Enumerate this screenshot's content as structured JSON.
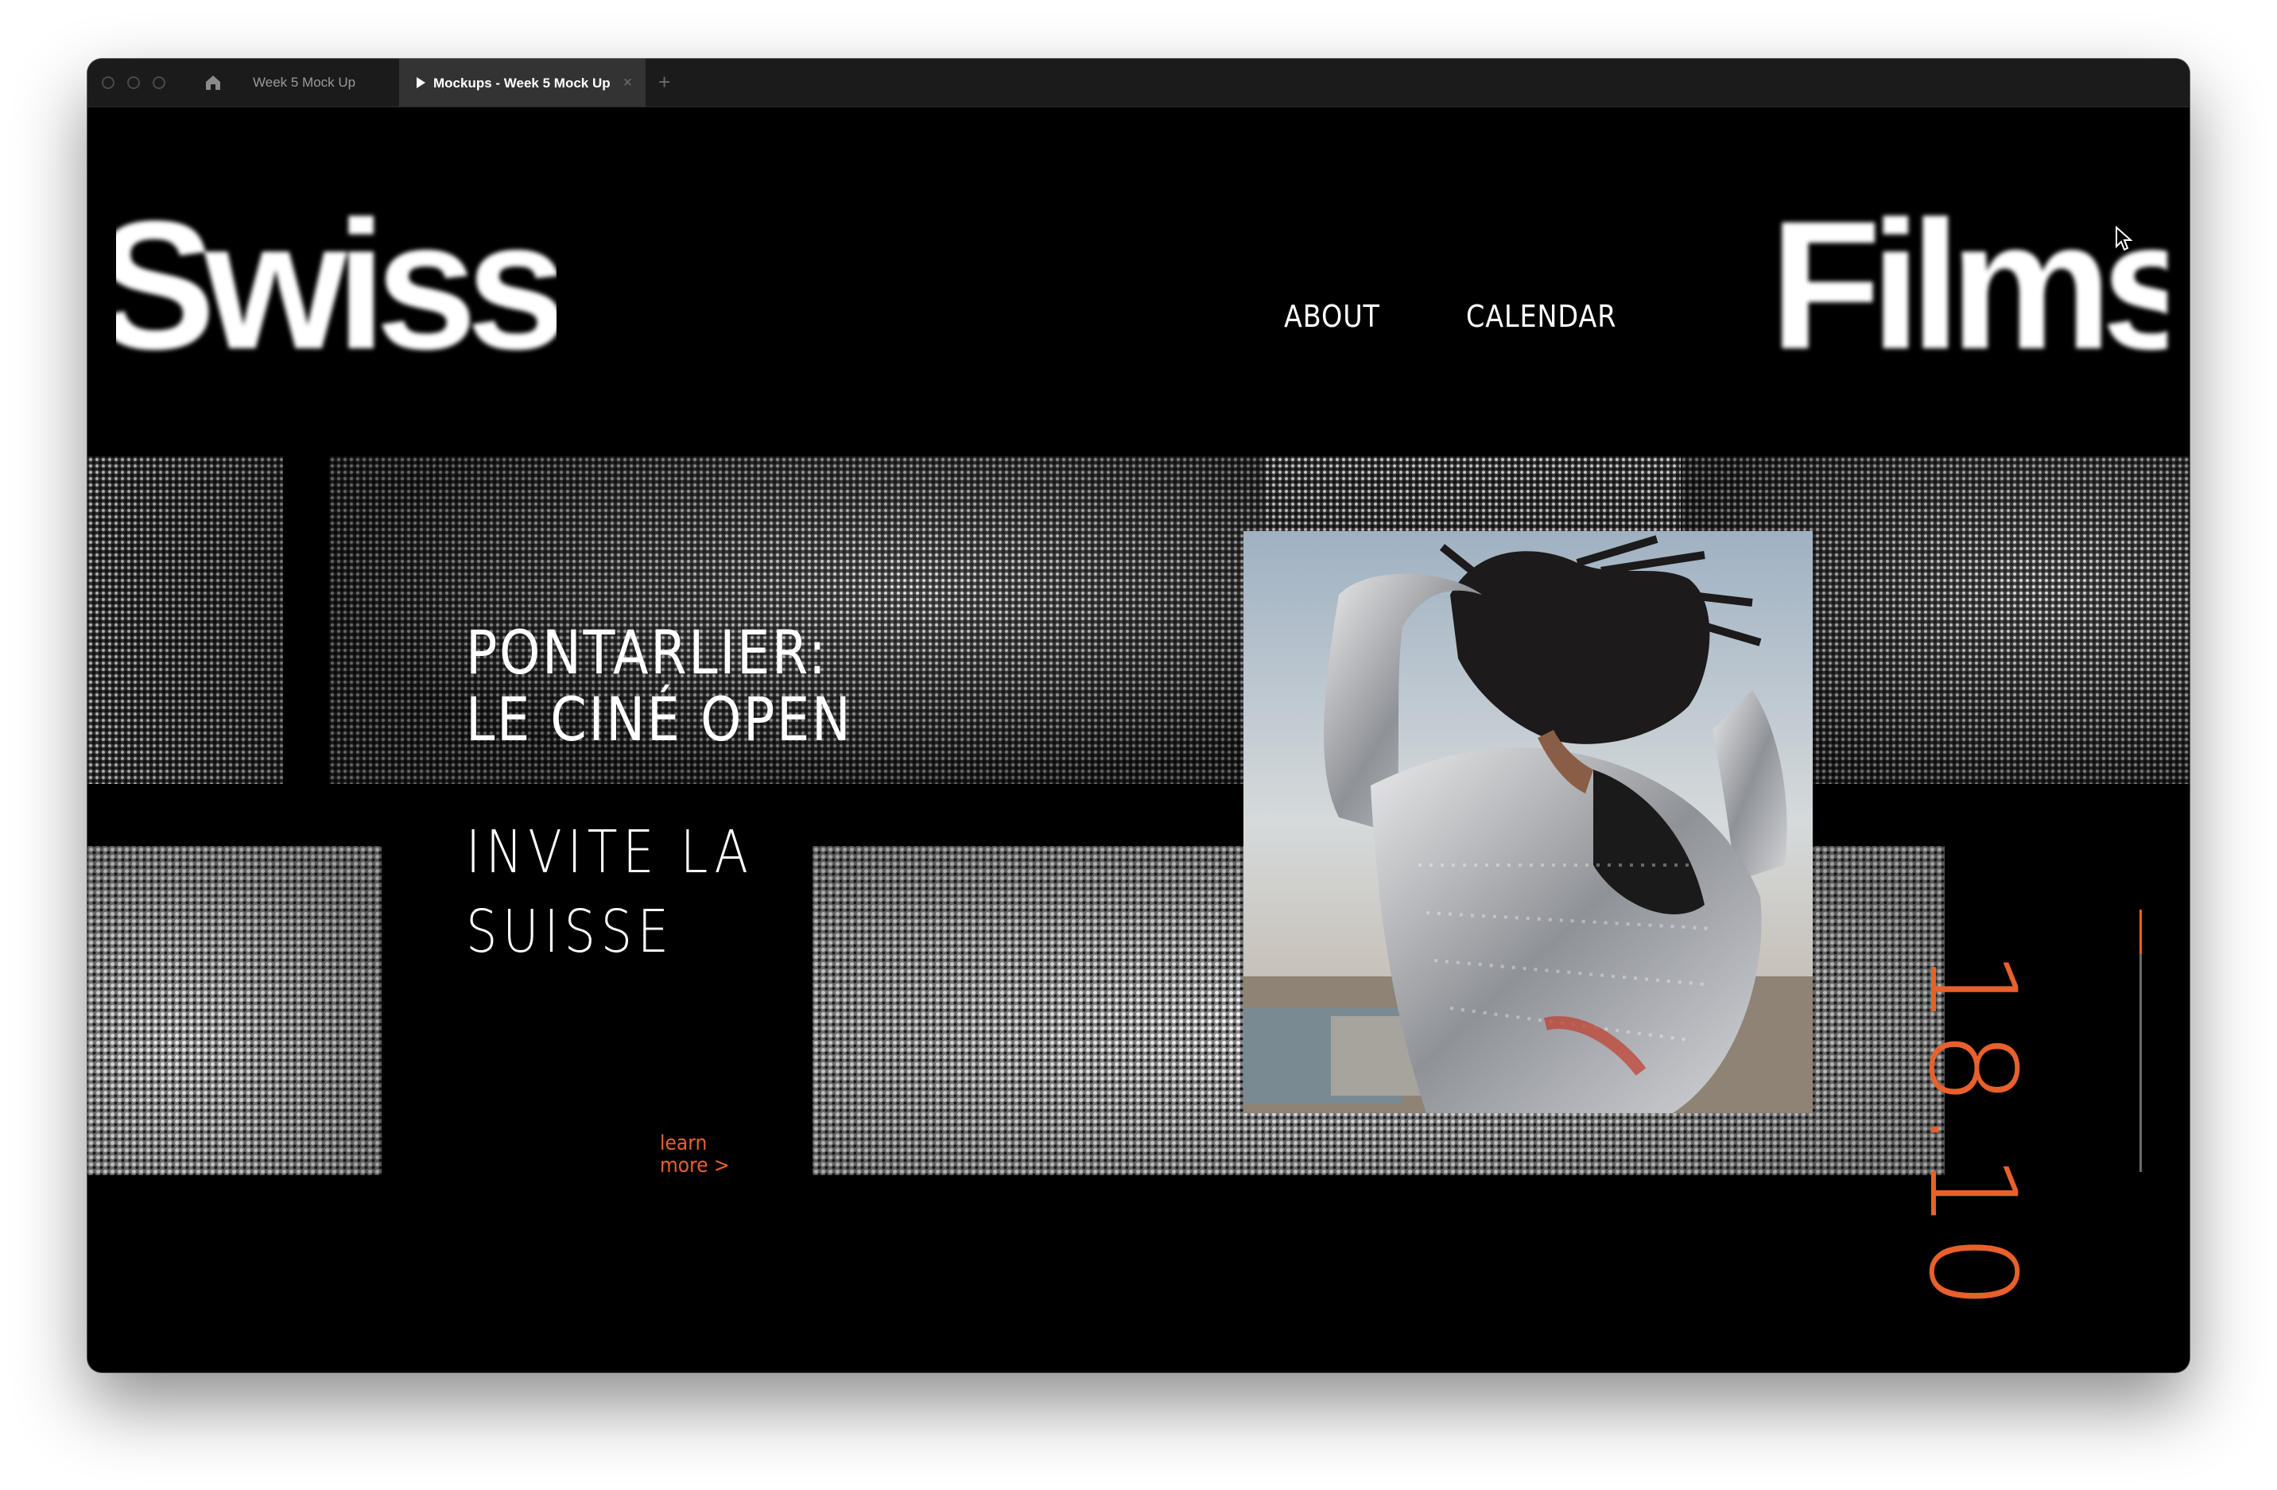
{
  "tabs": {
    "home_icon": "home-icon",
    "items": [
      {
        "label": "Week 5 Mock Up",
        "active": false
      },
      {
        "label": "Mockups - Week 5 Mock Up",
        "active": true
      }
    ],
    "new_tab_label": "+",
    "close_label": "×"
  },
  "site": {
    "logo_left": "Swiss",
    "logo_right": "Films",
    "nav": {
      "about": "ABOUT",
      "calendar": "CALENDAR"
    }
  },
  "hero": {
    "headline_line1": "PONTARLIER:",
    "headline_line2": "LE CINÉ OPEN",
    "subhead_line1": "INVITE LA",
    "subhead_line2": "SUISSE",
    "learn_more_line1": "learn",
    "learn_more_line2": "more >",
    "date": "18.10",
    "date_progress_fraction": 0.17
  },
  "colors": {
    "accent": "#e8602c",
    "background": "#000000",
    "text": "#ffffff"
  }
}
